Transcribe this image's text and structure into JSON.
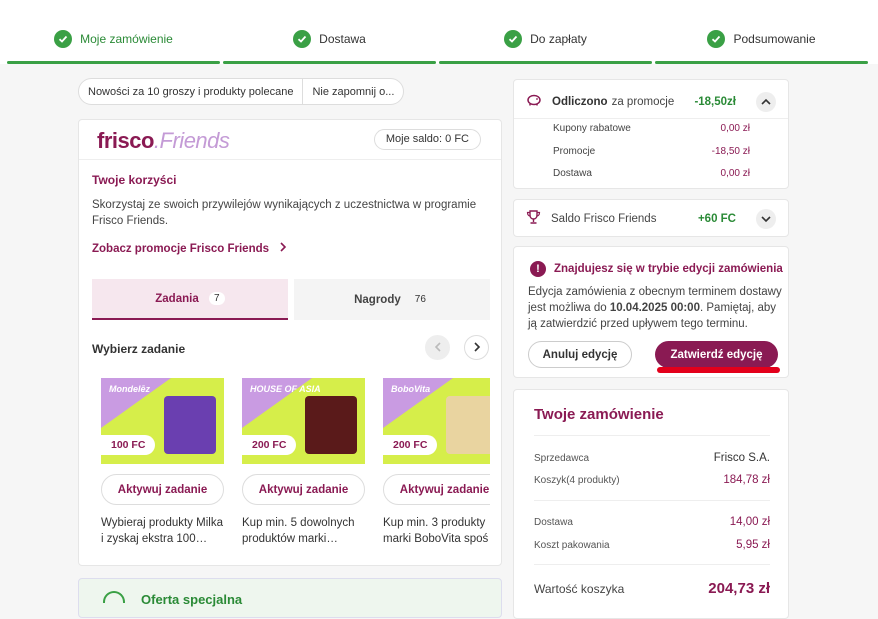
{
  "steps": [
    {
      "label": "Moje zamówienie"
    },
    {
      "label": "Dostawa"
    },
    {
      "label": "Do zapłaty"
    },
    {
      "label": "Podsumowanie"
    }
  ],
  "chips": [
    "Nowości za 10 groszy i produkty polecane",
    "Nie zapomnij o..."
  ],
  "friends": {
    "brand_main": "frisco",
    "brand_dot": ".",
    "brand_friends": "Friends",
    "saldo": "Moje saldo: 0 FC",
    "benefits_title": "Twoje korzyści",
    "benefits_text": "Skorzystaj ze swoich przywilejów wynikających z uczestnictwa w programie Frisco Friends.",
    "promo_link": "Zobacz promocje Frisco Friends",
    "tabs": [
      {
        "label": "Zadania",
        "count": "7"
      },
      {
        "label": "Nagrody",
        "count": "76"
      }
    ],
    "choose_label": "Wybierz zadanie",
    "tasks": [
      {
        "brand": "Mondelēz",
        "fc": "100 FC",
        "action": "Aktywuj zadanie",
        "desc": "Wybieraj produkty Milka i zyskaj ekstra 100…",
        "color": "#6a3fb0"
      },
      {
        "brand": "HOUSE OF ASIA",
        "fc": "200 FC",
        "action": "Aktywuj zadanie",
        "desc": "Kup min. 5 dowolnych produktów marki…",
        "color": "#5a1a1a"
      },
      {
        "brand": "BoboVita",
        "fc": "200 FC",
        "action": "Aktywuj zadanie",
        "desc": "Kup min. 3 produkty marki BoboVita spoś",
        "color": "#e9d4a0"
      }
    ]
  },
  "special": {
    "label": "Oferta specjalna"
  },
  "discount": {
    "title": "Odliczono",
    "subtitle": "za promocje",
    "value": "-18,50zł",
    "rows": [
      {
        "label": "Kupony rabatowe",
        "value": "0,00 zł"
      },
      {
        "label": "Promocje",
        "value": "-18,50 zł"
      },
      {
        "label": "Dostawa",
        "value": "0,00 zł"
      }
    ]
  },
  "saldo_friends": {
    "label": "Saldo Frisco Friends",
    "value": "+60 FC"
  },
  "edit": {
    "title": "Znajdujesz się w trybie edycji zamówienia",
    "text_before": "Edycja zamówienia z obecnym terminem dostawy jest możliwa do ",
    "deadline": "10.04.2025 00:00",
    "text_after": ". Pamiętaj, aby ją zatwierdzić przed upływem tego terminu.",
    "cancel": "Anuluj edycję",
    "confirm": "Zatwierdź edycję"
  },
  "order": {
    "title": "Twoje zamówienie",
    "seller_label": "Sprzedawca",
    "seller": "Frisco S.A.",
    "cart_label": "Koszyk(4 produkty)",
    "cart_value": "184,78 zł",
    "delivery_label": "Dostawa",
    "delivery_value": "14,00 zł",
    "packing_label": "Koszt pakowania",
    "packing_value": "5,95 zł",
    "total_label": "Wartość koszyka",
    "total_value": "204,73 zł"
  }
}
